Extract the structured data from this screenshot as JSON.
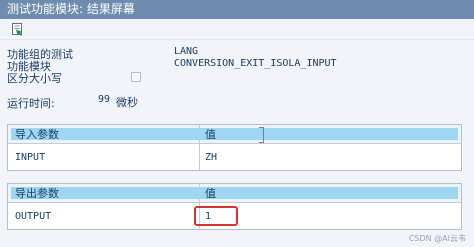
{
  "window": {
    "title": "测试功能模块: 结果屏幕"
  },
  "toolbar": {
    "execute_icon": "execute-icon"
  },
  "info": {
    "function_group_label": "功能组的测试",
    "function_group_value": "LANG",
    "function_module_label": "功能模块",
    "function_module_value": "CONVERSION_EXIT_ISOLA_INPUT",
    "case_sensitive_label": "区分大小写",
    "case_sensitive_checked": false,
    "runtime_label": "运行时间:",
    "runtime_value": "99",
    "runtime_unit": "微秒"
  },
  "import_table": {
    "header_param": "导入参数",
    "header_value": "值",
    "rows": [
      {
        "param": "INPUT",
        "value": "ZH"
      }
    ]
  },
  "export_table": {
    "header_param": "导出参数",
    "header_value": "值",
    "rows": [
      {
        "param": "OUTPUT",
        "value": "1"
      }
    ]
  },
  "watermark": "CSDN @AI云韦",
  "colors": {
    "title_bar": "#6f8cae",
    "header_band": "#9fd7f3",
    "highlight": "#d7352c"
  }
}
